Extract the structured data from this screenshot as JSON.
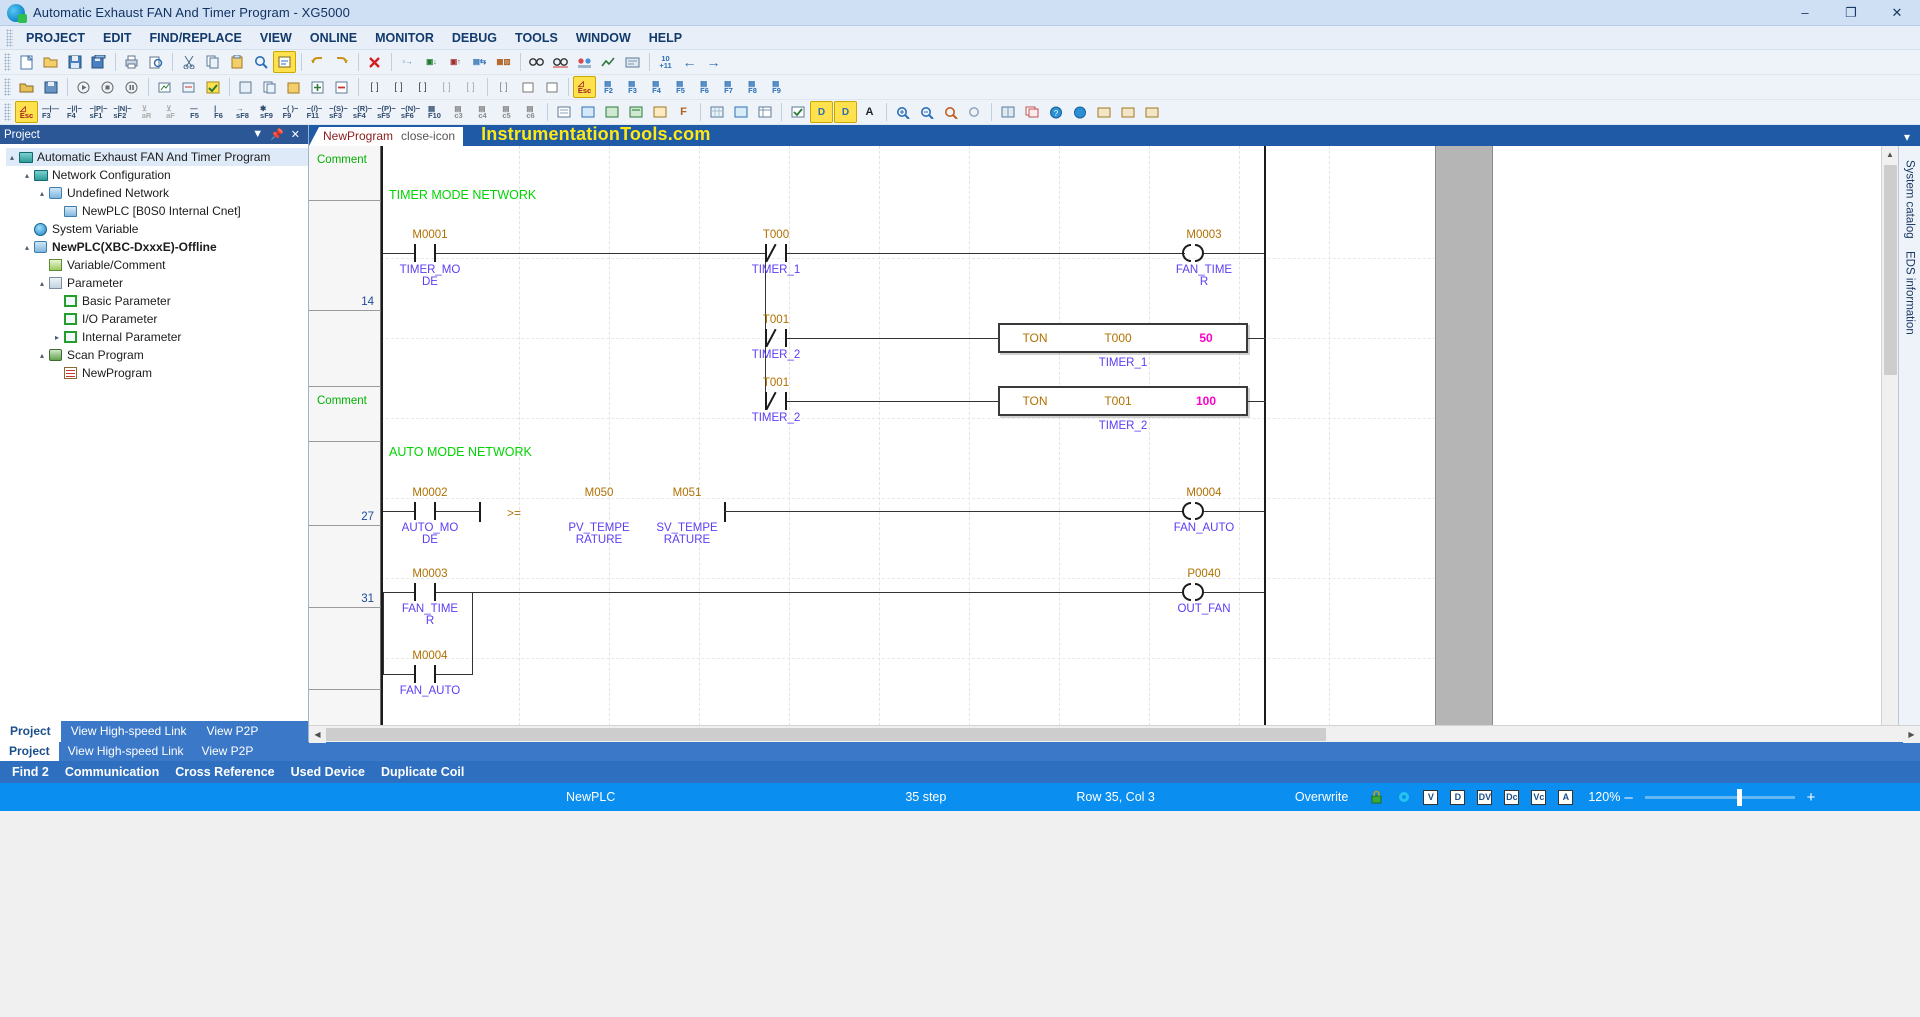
{
  "window": {
    "title": "Automatic Exhaust FAN And Timer Program - XG5000",
    "logo_icon": "xg5000-logo-icon",
    "minimize": "–",
    "maximize": "❐",
    "close": "✕"
  },
  "menubar": {
    "items": [
      "PROJECT",
      "EDIT",
      "FIND/REPLACE",
      "VIEW",
      "ONLINE",
      "MONITOR",
      "DEBUG",
      "TOOLS",
      "WINDOW",
      "HELP"
    ]
  },
  "toolbar_rows": {
    "row1_keys": [
      "Esc",
      "F3",
      "F4",
      "sF1",
      "sF2",
      "aR",
      "aF",
      "F5",
      "F6",
      "sF8",
      "sF9",
      "F9",
      "F11",
      "sF3",
      "sF4",
      "sF5",
      "sF6",
      "F10",
      "c3",
      "c4",
      "c5",
      "c6"
    ]
  },
  "project_panel": {
    "title": "Project",
    "auto_hide_icon": "pin-icon",
    "close_icon": "close-icon",
    "dropdown_icon": "chevron-down-icon",
    "tree": [
      {
        "label": "Automatic Exhaust FAN And Timer Program",
        "indent": 0,
        "icon": "network-config-icon",
        "twisty": "▴",
        "bold": false,
        "selected": true
      },
      {
        "label": "Network Configuration",
        "indent": 1,
        "icon": "network-config-icon",
        "twisty": "▴",
        "bold": false
      },
      {
        "label": "Undefined Network",
        "indent": 2,
        "icon": "network-box-icon",
        "twisty": "▴",
        "bold": false
      },
      {
        "label": "NewPLC [B0S0 Internal Cnet]",
        "indent": 3,
        "icon": "plc-device-icon",
        "twisty": "",
        "bold": false
      },
      {
        "label": "System Variable",
        "indent": 1,
        "icon": "system-variable-icon",
        "twisty": "",
        "bold": false
      },
      {
        "label": "NewPLC(XBC-DxxxE)-Offline",
        "indent": 1,
        "icon": "plc-cpu-icon",
        "twisty": "▴",
        "bold": true
      },
      {
        "label": "Variable/Comment",
        "indent": 2,
        "icon": "variable-comment-icon",
        "twisty": "",
        "bold": false
      },
      {
        "label": "Parameter",
        "indent": 2,
        "icon": "parameter-icon",
        "twisty": "▴",
        "bold": false
      },
      {
        "label": "Basic Parameter",
        "indent": 3,
        "icon": "basic-parameter-icon",
        "twisty": "",
        "bold": false
      },
      {
        "label": "I/O Parameter",
        "indent": 3,
        "icon": "io-parameter-icon",
        "twisty": "",
        "bold": false
      },
      {
        "label": "Internal Parameter",
        "indent": 3,
        "icon": "internal-parameter-icon",
        "twisty": "▸",
        "bold": false
      },
      {
        "label": "Scan Program",
        "indent": 2,
        "icon": "scan-program-icon",
        "twisty": "▴",
        "bold": false
      },
      {
        "label": "NewProgram",
        "indent": 3,
        "icon": "program-icon",
        "twisty": "",
        "bold": false
      }
    ],
    "tabs": [
      {
        "label": "Project",
        "active": true
      },
      {
        "label": "View High-speed Link",
        "active": false
      },
      {
        "label": "View P2P",
        "active": false
      }
    ]
  },
  "editor": {
    "tab": {
      "label": "NewProgram",
      "close_icon": "close-icon"
    },
    "watermark": "InstrumentationTools.com",
    "strip_caret": "▾"
  },
  "right_docks": [
    {
      "label": "System catalog"
    },
    {
      "label": "EDS information"
    }
  ],
  "ladder": {
    "comment_label": "Comment",
    "networks": [
      {
        "title": "TIMER MODE NETWORK",
        "step": "14"
      },
      {
        "title": "AUTO MODE NETWORK",
        "steps": [
          "27",
          "31"
        ]
      }
    ],
    "elements": {
      "m0001": {
        "addr": "M0001",
        "sym_l1": "TIMER_MO",
        "sym_l2": "DE",
        "type": "NO"
      },
      "t000_contact": {
        "addr": "T000",
        "sym": "TIMER_1",
        "type": "NC"
      },
      "t001_contact_a": {
        "addr": "T001",
        "sym": "TIMER_2",
        "type": "NC"
      },
      "t001_contact_b": {
        "addr": "T001",
        "sym": "TIMER_2",
        "type": "NC"
      },
      "m0003_coil": {
        "addr": "M0003",
        "sym_l1": "FAN_TIME",
        "sym_l2": "R"
      },
      "ton1": {
        "op": "TON",
        "arg": "T000",
        "val": "50",
        "sym": "TIMER_1"
      },
      "ton2": {
        "op": "TON",
        "arg": "T001",
        "val": "100",
        "sym": "TIMER_2"
      },
      "m0002": {
        "addr": "M0002",
        "sym_l1": "AUTO_MO",
        "sym_l2": "DE",
        "type": "NO"
      },
      "compare": {
        "op": ">=",
        "a_addr": "M050",
        "a_sym_l1": "PV_TEMPE",
        "a_sym_l2": "RATURE",
        "b_addr": "M051",
        "b_sym_l1": "SV_TEMPE",
        "b_sym_l2": "RATURE"
      },
      "m0004_coil": {
        "addr": "M0004",
        "sym": "FAN_AUTO"
      },
      "m0003_contact": {
        "addr": "M0003",
        "sym_l1": "FAN_TIME",
        "sym_l2": "R",
        "type": "NO"
      },
      "m0004_contact": {
        "addr": "M0004",
        "sym": "FAN_AUTO",
        "type": "NO"
      },
      "p0040_coil": {
        "addr": "P0040",
        "sym": "OUT_FAN"
      }
    }
  },
  "output_tabs": [
    "Find 2",
    "Communication",
    "Cross Reference",
    "Used Device",
    "Duplicate Coil"
  ],
  "statusbar": {
    "plc": "NewPLC",
    "step": "35 step",
    "rowcol": "Row 35, Col 3",
    "mode": "Overwrite",
    "lock_icon": "lock-icon",
    "net_icon": "network-status-icon",
    "doc_icons": [
      "V",
      "D",
      "DV",
      "Dc",
      "Vc",
      "A"
    ],
    "zoom": "120%",
    "zoom_out": "–",
    "zoom_in": "+"
  },
  "colors": {
    "accent": "#0a8ef0",
    "title_bar": "#cfe0f5",
    "tab_active": "#2b5797",
    "comment_green": "#00d400",
    "symbol_purple": "#5b3df5",
    "address_orange": "#b07000",
    "value_magenta": "#ff00c8",
    "watermark_yellow": "#ffe814"
  }
}
